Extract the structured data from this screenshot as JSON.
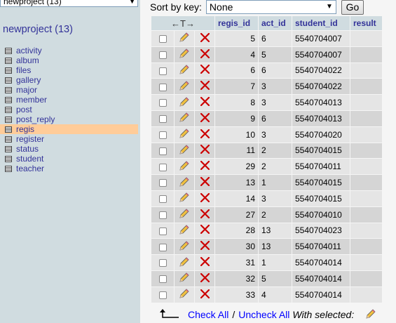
{
  "nav": {
    "db_select_value": "newproject (13)",
    "db_title": "newproject (13)",
    "tables": [
      "activity",
      "album",
      "files",
      "gallery",
      "major",
      "member",
      "post",
      "post_reply",
      "regis",
      "register",
      "status",
      "student",
      "teacher"
    ],
    "active_table": "regis"
  },
  "sort": {
    "label": "Sort by key:",
    "value": "None",
    "go_label": "Go"
  },
  "table": {
    "columns": [
      "regis_id",
      "act_id",
      "student_id",
      "result"
    ],
    "rows": [
      {
        "regis_id": "5",
        "act_id": "6",
        "student_id": "5540704007",
        "result": ""
      },
      {
        "regis_id": "4",
        "act_id": "5",
        "student_id": "5540704007",
        "result": ""
      },
      {
        "regis_id": "6",
        "act_id": "6",
        "student_id": "5540704022",
        "result": ""
      },
      {
        "regis_id": "7",
        "act_id": "3",
        "student_id": "5540704022",
        "result": ""
      },
      {
        "regis_id": "8",
        "act_id": "3",
        "student_id": "5540704013",
        "result": ""
      },
      {
        "regis_id": "9",
        "act_id": "6",
        "student_id": "5540704013",
        "result": ""
      },
      {
        "regis_id": "10",
        "act_id": "3",
        "student_id": "5540704020",
        "result": ""
      },
      {
        "regis_id": "11",
        "act_id": "2",
        "student_id": "5540704015",
        "result": ""
      },
      {
        "regis_id": "29",
        "act_id": "2",
        "student_id": "5540704011",
        "result": ""
      },
      {
        "regis_id": "13",
        "act_id": "1",
        "student_id": "5540704015",
        "result": ""
      },
      {
        "regis_id": "14",
        "act_id": "3",
        "student_id": "5540704015",
        "result": ""
      },
      {
        "regis_id": "27",
        "act_id": "2",
        "student_id": "5540704010",
        "result": ""
      },
      {
        "regis_id": "28",
        "act_id": "13",
        "student_id": "5540704023",
        "result": ""
      },
      {
        "regis_id": "30",
        "act_id": "13",
        "student_id": "5540704011",
        "result": ""
      },
      {
        "regis_id": "31",
        "act_id": "1",
        "student_id": "5540704014",
        "result": ""
      },
      {
        "regis_id": "32",
        "act_id": "5",
        "student_id": "5540704014",
        "result": ""
      },
      {
        "regis_id": "33",
        "act_id": "4",
        "student_id": "5540704014",
        "result": ""
      }
    ]
  },
  "footer": {
    "check_all": "Check All",
    "separator": "/",
    "uncheck_all": "Uncheck All",
    "with_selected": "With selected:"
  },
  "colors": {
    "nav_bg": "#d0dce0",
    "link": "#333399",
    "active_row": "#ffcc99",
    "delete": "#cc0000"
  }
}
